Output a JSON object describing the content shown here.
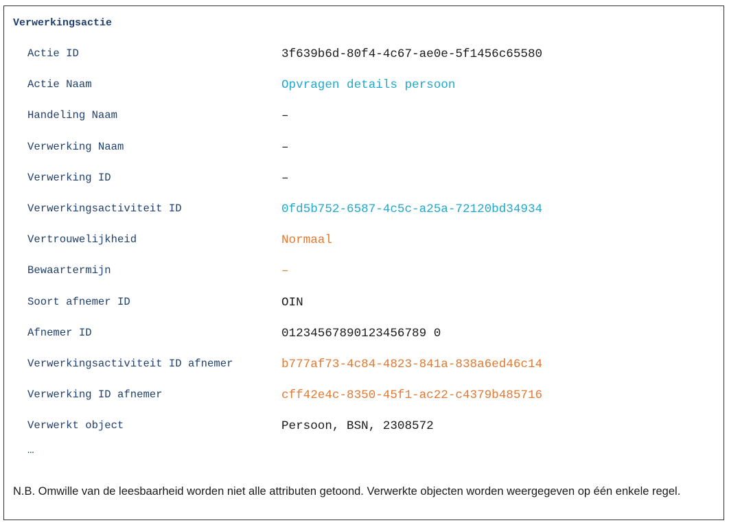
{
  "heading": "Verwerkingsactie",
  "colors": {
    "label": "#1f3f6e",
    "default": "#1a1a1a",
    "link": "#1fa8cc",
    "highlight": "#e07a35"
  },
  "rows": [
    {
      "label": "Actie ID",
      "value": "3f639b6d-80f4-4c67-ae0e-5f1456c65580",
      "color": "#1a1a1a"
    },
    {
      "label": "Actie Naam",
      "value": "Opvragen details persoon",
      "color": "#1fa8cc"
    },
    {
      "label": "Handeling Naam",
      "value": "–",
      "color": "#1a1a1a"
    },
    {
      "label": "Verwerking Naam",
      "value": "–",
      "color": "#1a1a1a"
    },
    {
      "label": "Verwerking ID",
      "value": "–",
      "color": "#1a1a1a"
    },
    {
      "label": "Verwerkingsactiviteit ID",
      "value": "0fd5b752-6587-4c5c-a25a-72120bd34934",
      "color": "#1fa8cc"
    },
    {
      "label": "Vertrouwelijkheid",
      "value": "Normaal",
      "color": "#e07a35"
    },
    {
      "label": "Bewaartermijn",
      "value": "–",
      "color": "#e07a35"
    },
    {
      "label": "Soort afnemer ID",
      "value": "OIN",
      "color": "#1a1a1a"
    },
    {
      "label": "Afnemer ID",
      "value": "01234567890123456789 0",
      "color": "#1a1a1a"
    },
    {
      "label": "Verwerkingsactiviteit ID afnemer",
      "value": "b777af73-4c84-4823-841a-838a6ed46c14",
      "color": "#e07a35"
    },
    {
      "label": "Verwerking ID afnemer",
      "value": "cff42e4c-8350-45f1-ac22-c4379b485716",
      "color": "#e07a35"
    },
    {
      "label": "Verwerkt object",
      "value": "Persoon, BSN, 2308572",
      "color": "#1a1a1a"
    }
  ],
  "ellipsis": "…",
  "note": "N.B. Omwille van de leesbaarheid worden niet alle attributen getoond. Verwerkte objecten worden weergegeven op één enkele regel."
}
